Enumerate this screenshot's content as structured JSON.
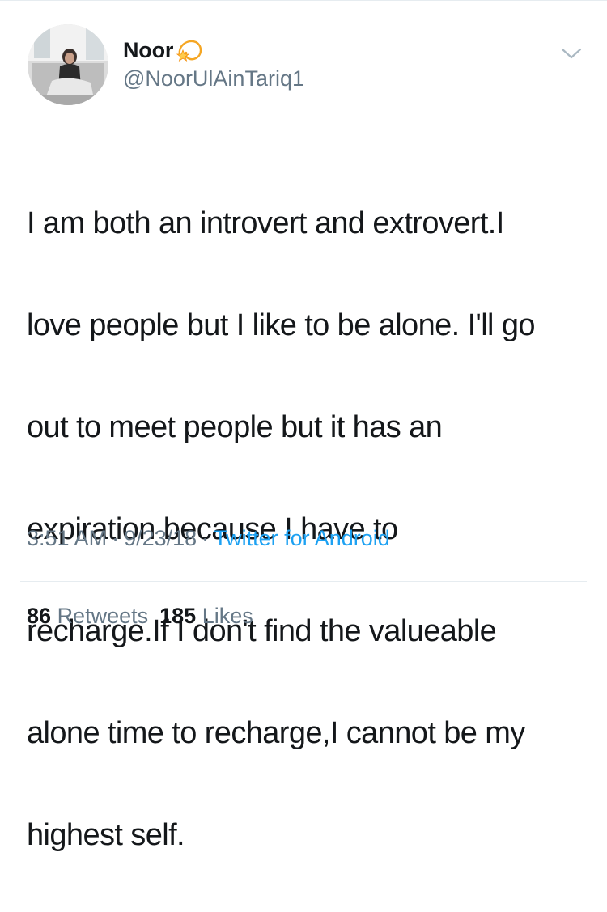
{
  "tweet": {
    "author": {
      "display_name": "Noor",
      "handle": "@NoorUlAinTariq1",
      "name_emoji_icon": "dizzy-star-icon",
      "avatar": "profile-photo"
    },
    "menu_icon": "chevron-down-icon",
    "text_lines": [
      "I am both an introvert and extrovert.I",
      "love people but I like to be alone. I'll go",
      "out to meet people but it has an",
      "expiration because I have to",
      "recharge.If I don't find the valueable",
      "alone time to recharge,I cannot be my",
      "highest self."
    ],
    "time": "3:51 AM",
    "date": "9/23/18",
    "separator": "·",
    "source": "Twitter for Android",
    "retweets_count": "86",
    "retweets_label": "Retweets",
    "likes_count": "185",
    "likes_label": "Likes"
  },
  "colors": {
    "text": "#14171a",
    "secondary": "#657786",
    "link": "#1da1f2",
    "divider": "#e6ecf0"
  }
}
